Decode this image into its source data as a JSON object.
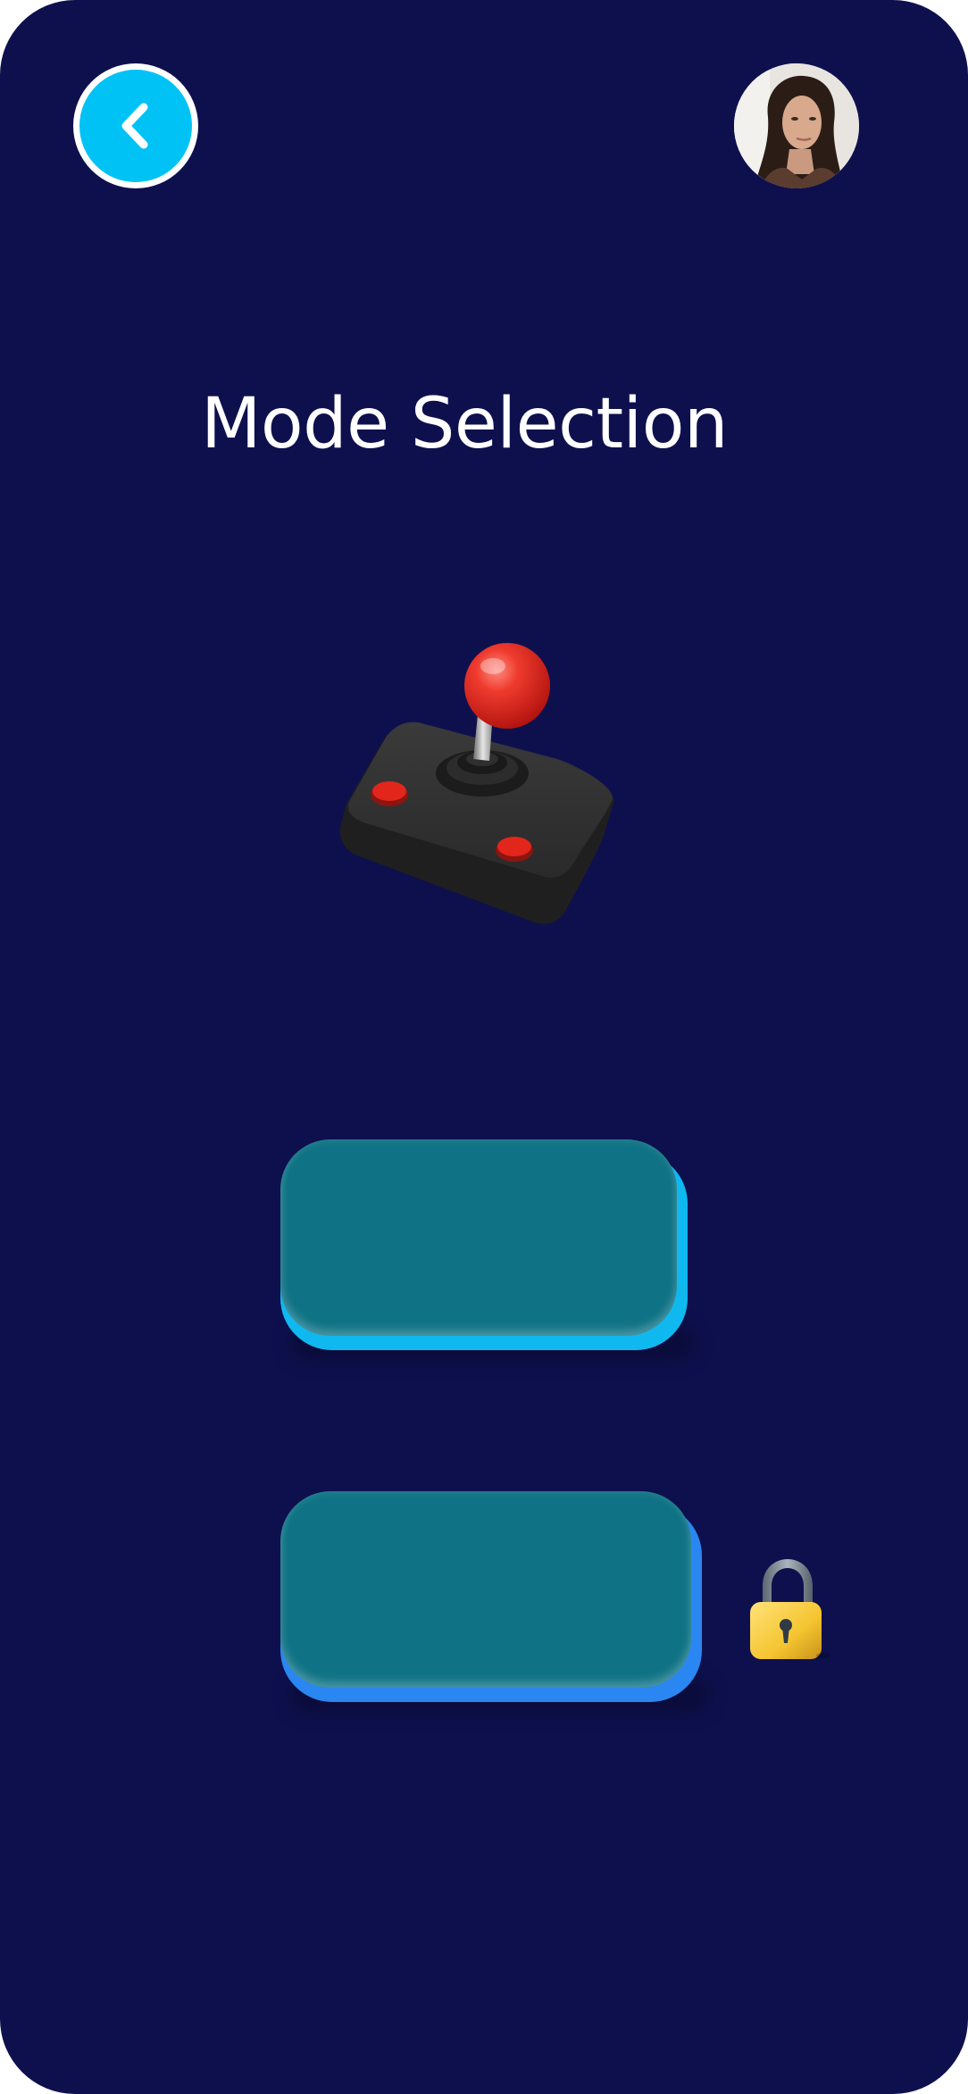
{
  "screen": {
    "title": "Mode Selection",
    "background_color": "#0e104e",
    "accent_color": "#00c2f5"
  },
  "header": {
    "back_button_icon": "chevron-left-icon",
    "avatar_icon": "user-avatar"
  },
  "illustration": {
    "icon": "joystick-icon"
  },
  "modes": [
    {
      "label": "",
      "locked": false,
      "face_color": "#0f7385",
      "edge_color": "#10b8f0"
    },
    {
      "label": "",
      "locked": true,
      "face_color": "#0f7385",
      "edge_color": "#2a86f0",
      "lock_icon": "padlock-icon"
    }
  ]
}
